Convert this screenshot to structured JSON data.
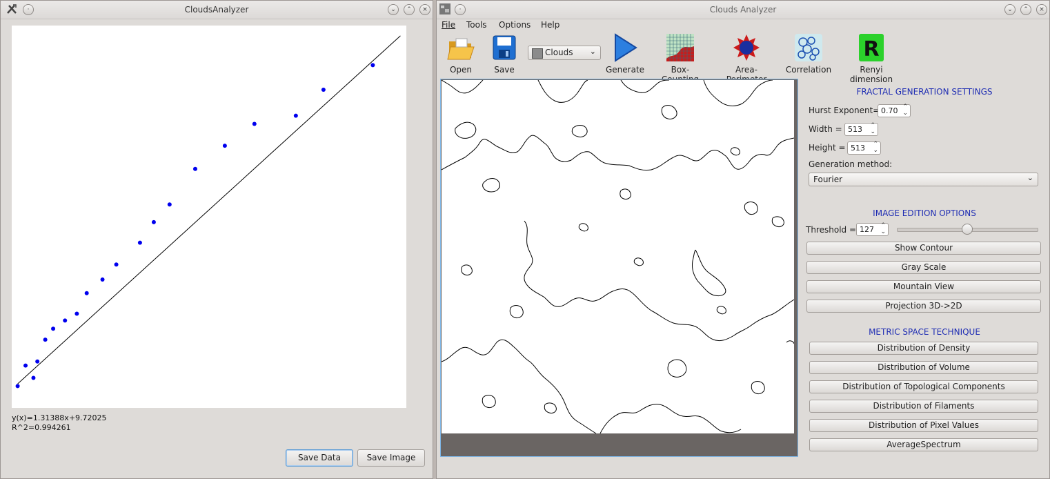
{
  "left_window": {
    "title": "CloudsAnalyzer",
    "fit_equation": "y(x)=1.31388x+9.72025",
    "r_squared": "R^2=0.994261",
    "buttons": {
      "save_data": "Save Data",
      "save_image": "Save Image"
    }
  },
  "chart_data": {
    "type": "scatter",
    "title": "",
    "xlabel": "",
    "ylabel": "",
    "grid": false,
    "point_color": "#0000ee",
    "fit_line": {
      "slope": 1.31388,
      "intercept": 9.72025
    },
    "x": [
      1.8,
      2.2,
      2.6,
      2.8,
      3.2,
      3.6,
      4.2,
      4.8,
      5.3,
      6.1,
      6.8,
      8.0,
      8.7,
      9.5,
      10.8,
      12.3,
      13.8,
      15.9,
      17.3,
      19.8
    ],
    "y": [
      11.6,
      13.1,
      12.2,
      13.4,
      15.0,
      15.8,
      16.4,
      16.9,
      18.4,
      19.4,
      20.5,
      22.1,
      23.6,
      24.9,
      27.5,
      29.2,
      30.8,
      31.4,
      33.3,
      35.1
    ]
  },
  "main_window": {
    "title": "Clouds Analyzer",
    "menu": [
      "File",
      "Tools",
      "Options",
      "Help"
    ],
    "toolbar": {
      "open": "Open",
      "save": "Save",
      "combo_value": "Clouds",
      "generate": "Generate",
      "box_counting": "Box-Counting",
      "area_perimeter": "Area-Perimeter",
      "correlation": "Correlation",
      "renyi": "Renyi dimension"
    },
    "fractal_settings": {
      "heading": "FRACTAL GENERATION SETTINGS",
      "hurst_label": "Hurst Exponent=",
      "hurst_value": "0.70",
      "width_label": "Width =",
      "width_value": "513",
      "height_label": "Height =",
      "height_value": "513",
      "method_label": "Generation method:",
      "method_value": "Fourier"
    },
    "image_edition": {
      "heading": "IMAGE EDITION OPTIONS",
      "threshold_label": "Threshold =",
      "threshold_value": "127",
      "threshold_level": 0.5,
      "buttons": [
        "Show Contour",
        "Gray Scale",
        "Mountain View",
        "Projection 3D->2D"
      ]
    },
    "metric_space": {
      "heading": "METRIC SPACE TECHNIQUE",
      "buttons": [
        "Distribution of Density",
        "Distribution of Volume",
        "Distribution of Topological Components",
        "Distribution of Filaments",
        "Distribution of Pixel Values",
        "AverageSpectrum"
      ]
    }
  }
}
